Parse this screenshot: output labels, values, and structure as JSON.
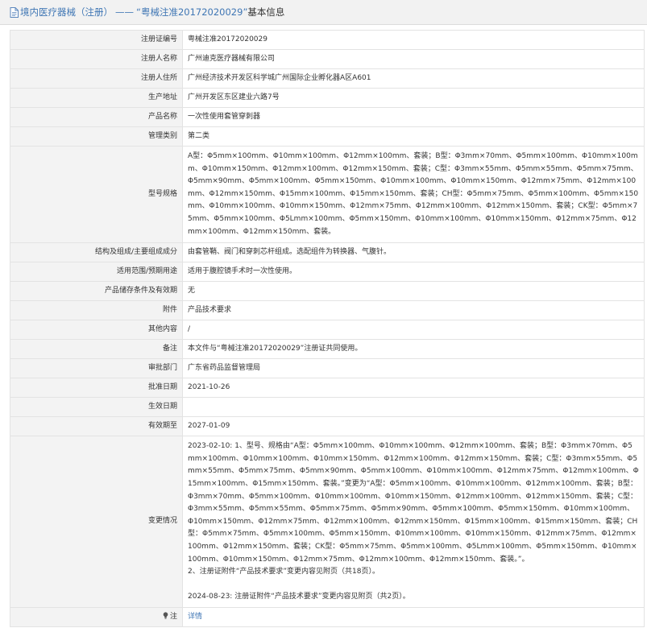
{
  "breadcrumb": {
    "part1": "境内医疗器械",
    "part2": "（注册）",
    "sep": "——",
    "current": "“粤械注准20172020029”",
    "rest": "基本信息"
  },
  "rows": [
    {
      "label": "注册证编号",
      "value": "粤械注准20172020029"
    },
    {
      "label": "注册人名称",
      "value": "广州迪克医疗器械有限公司"
    },
    {
      "label": "注册人住所",
      "value": "广州经济技术开发区科学城广州国际企业孵化器A区A601"
    },
    {
      "label": "生产地址",
      "value": "广州开发区东区建业六路7号"
    },
    {
      "label": "产品名称",
      "value": "一次性使用套管穿刺器"
    },
    {
      "label": "管理类别",
      "value": "第二类"
    },
    {
      "label": "型号规格",
      "value": "A型：Φ5mm×100mm、Φ10mm×100mm、Φ12mm×100mm、套装；B型：Φ3mm×70mm、Φ5mm×100mm、Φ10mm×100mm、Φ10mm×150mm、Φ12mm×100mm、Φ12mm×150mm、套装；C型：Φ3mm×55mm、Φ5mm×55mm、Φ5mm×75mm、Φ5mm×90mm、Φ5mm×100mm、Φ5mm×150mm、Φ10mm×100mm、Φ10mm×150mm、Φ12mm×75mm、Φ12mm×100mm、Φ12mm×150mm、Φ15mm×100mm、Φ15mm×150mm、套装；CH型：Φ5mm×75mm、Φ5mm×100mm、Φ5mm×150mm、Φ10mm×100mm、Φ10mm×150mm、Φ12mm×75mm、Φ12mm×100mm、Φ12mm×150mm、套装；CK型：Φ5mm×75mm、Φ5mm×100mm、Φ5Lmm×100mm、Φ5mm×150mm、Φ10mm×100mm、Φ10mm×150mm、Φ12mm×75mm、Φ12mm×100mm、Φ12mm×150mm、套装。"
    },
    {
      "label": "结构及组成/主要组成成分",
      "value": "由套管鞘、阀门和穿刺芯杆组成。选配组件为转换器、气腹针。"
    },
    {
      "label": "适用范围/预期用途",
      "value": "适用于腹腔镜手术时一次性使用。"
    },
    {
      "label": "产品储存条件及有效期",
      "value": "无"
    },
    {
      "label": "附件",
      "value": "产品技术要求"
    },
    {
      "label": "其他内容",
      "value": "/"
    },
    {
      "label": "备注",
      "value": "本文件与“粤械注准20172020029”注册证共同使用。"
    },
    {
      "label": "审批部门",
      "value": "广东省药品监督管理局"
    },
    {
      "label": "批准日期",
      "value": "2021-10-26"
    },
    {
      "label": "生效日期",
      "value": ""
    },
    {
      "label": "有效期至",
      "value": "2027-01-09"
    }
  ],
  "changes": {
    "label": "变更情况",
    "para1": "2023-02-10: 1、型号、规格由“A型：Φ5mm×100mm、Φ10mm×100mm、Φ12mm×100mm、套装；B型：Φ3mm×70mm、Φ5mm×100mm、Φ10mm×100mm、Φ10mm×150mm、Φ12mm×100mm、Φ12mm×150mm、套装；C型：Φ3mm×55mm、Φ5mm×55mm、Φ5mm×75mm、Φ5mm×90mm、Φ5mm×100mm、Φ10mm×100mm、Φ12mm×75mm、Φ12mm×100mm、Φ15mm×100mm、Φ15mm×150mm、套装。”变更为“A型：Φ5mm×100mm、Φ10mm×100mm、Φ12mm×100mm、套装；B型：Φ3mm×70mm、Φ5mm×100mm、Φ10mm×100mm、Φ10mm×150mm、Φ12mm×100mm、Φ12mm×150mm、套装；C型：Φ3mm×55mm、Φ5mm×55mm、Φ5mm×75mm、Φ5mm×90mm、Φ5mm×100mm、Φ5mm×150mm、Φ10mm×100mm、Φ10mm×150mm、Φ12mm×75mm、Φ12mm×100mm、Φ12mm×150mm、Φ15mm×100mm、Φ15mm×150mm、套装；CH型：Φ5mm×75mm、Φ5mm×100mm、Φ5mm×150mm、Φ10mm×100mm、Φ10mm×150mm、Φ12mm×75mm、Φ12mm×100mm、Φ12mm×150mm、套装；CK型：Φ5mm×75mm、Φ5mm×100mm、Φ5Lmm×100mm、Φ5mm×150mm、Φ10mm×100mm、Φ10mm×150mm、Φ12mm×75mm、Φ12mm×100mm、Φ12mm×150mm、套装。”。",
    "para1b": "2、注册证附件“产品技术要求”变更内容见附页（共18页）。",
    "para2": "2024-08-23: 注册证附件“产品技术要求”变更内容见附页（共2页）。"
  },
  "note": {
    "label": "注",
    "link": "详情"
  },
  "colors": {
    "link": "#3f76b4",
    "label_bg": "#f3f3f3",
    "border": "#e3e3e3",
    "header_bg": "#f2f2f2"
  }
}
